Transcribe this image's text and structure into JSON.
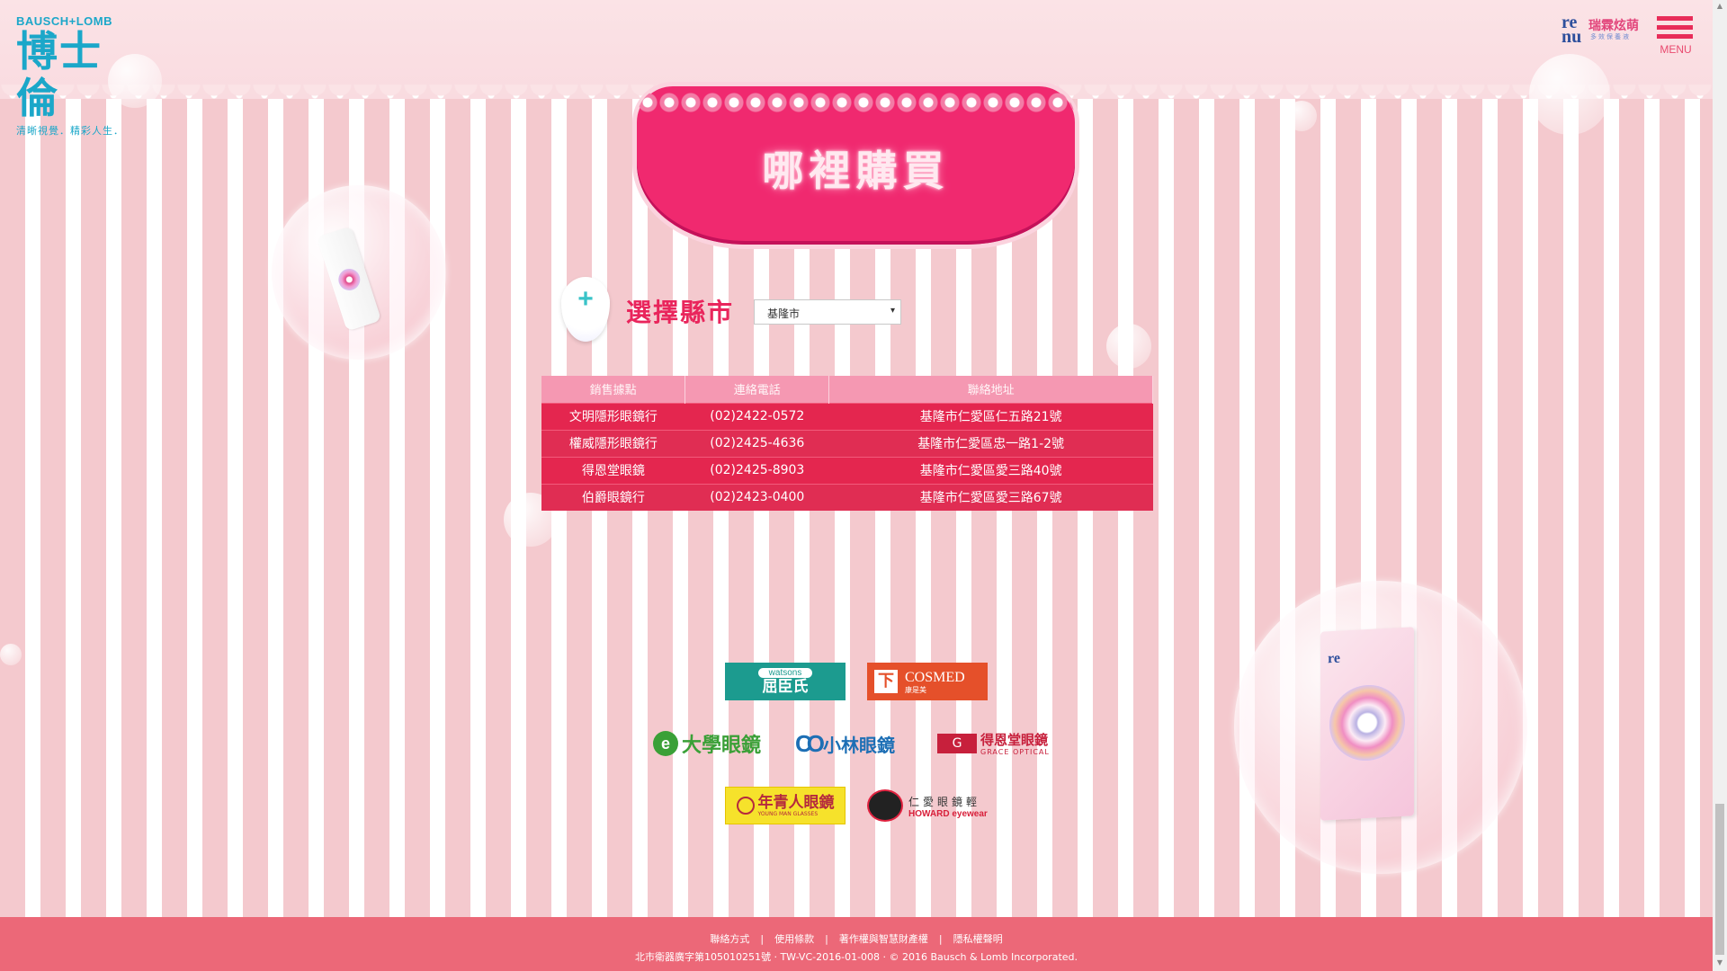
{
  "brand": {
    "name_en": "BAUSCH+LOMB",
    "name_zh": "博士倫",
    "slogan": "清晰視覺．精彩人生．"
  },
  "product_logo": {
    "re": "re",
    "nu": "nu",
    "name_zh": "瑞霖炫萌",
    "sub": "多效保養液"
  },
  "menu": {
    "label": "MENU"
  },
  "heading": {
    "title": "哪裡購買"
  },
  "city_selector": {
    "label": "選擇縣市",
    "selected": "基隆市",
    "arrow": "▾"
  },
  "stores_table": {
    "headers": [
      "銷售據點",
      "連絡電話",
      "聯絡地址"
    ],
    "rows": [
      [
        "文明隱形眼鏡行",
        "(02)2422-0572",
        "基隆市仁愛區仁五路21號"
      ],
      [
        "權威隱形眼鏡行",
        "(02)2425-4636",
        "基隆市仁愛區忠一路1-2號"
      ],
      [
        "得恩堂眼鏡",
        "(02)2425-8903",
        "基隆市仁愛區愛三路40號"
      ],
      [
        "伯爵眼鏡行",
        "(02)2423-0400",
        "基隆市仁愛區愛三路67號"
      ]
    ]
  },
  "retailers": {
    "watsons": {
      "en": "watsons",
      "zh": "屈臣氏"
    },
    "cosmed": {
      "mark": "下",
      "en": "COSMED",
      "zh": "康是美"
    },
    "daxue": {
      "mark": "e",
      "zh": "大學眼鏡"
    },
    "kobayashi": {
      "mark": "CO",
      "zh": "小林眼鏡"
    },
    "grace": {
      "mark": "G",
      "zh": "得恩堂眼鏡",
      "en": "GRACE OPTICAL"
    },
    "youth": {
      "zh": "年青人眼鏡",
      "en": "YOUNG MAN GLASSES"
    },
    "howard": {
      "zh": "仁愛眼鏡輕",
      "en": "HOWARD eyewear"
    }
  },
  "footer": {
    "links": [
      "聯絡方式",
      "使用條款",
      "著作權與智慧財產權",
      "隱私權聲明"
    ],
    "separator": "|",
    "legal": "北市衛器廣字第105010251號 · TW-VC-2016-01-008 · © 2016 Bausch & Lomb Incorporated."
  },
  "colors": {
    "accent": "#e82c59",
    "table_body": "#e4264f",
    "table_header": "#f598b2",
    "footer": "#ec6878",
    "brand_blue": "#1ba7c9"
  },
  "icons": {
    "pin": "location-pin-icon",
    "menu": "hamburger-icon"
  }
}
